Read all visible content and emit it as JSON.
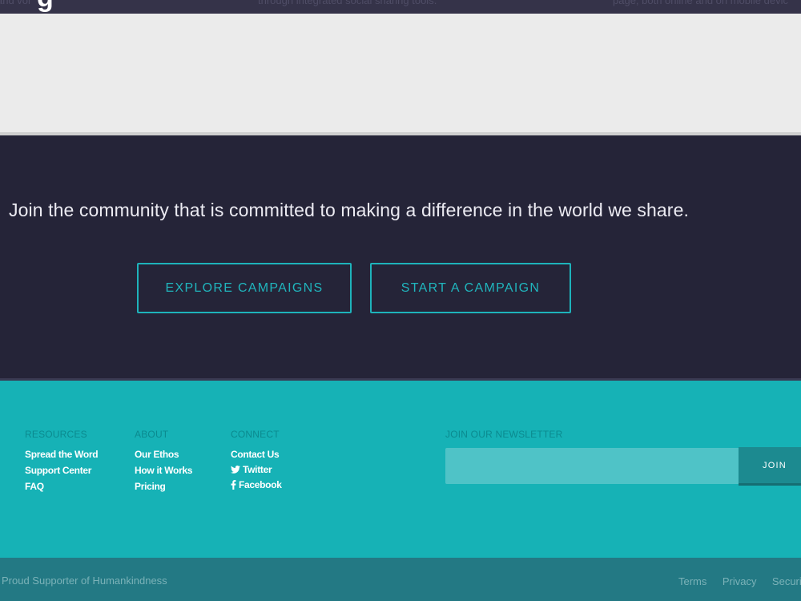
{
  "top_strip": {
    "left_fragment": "and vol",
    "big_char": "g",
    "mid_fragment": "through integrated social sharing tools.",
    "right_fragment": "page, both online and on mobile devic"
  },
  "cta": {
    "headline": "Join the community that is committed to making a difference in the world we share.",
    "explore_label": "EXPLORE CAMPAIGNS",
    "start_label": "START A CAMPAIGN",
    "accent_color": "#1eb3bb"
  },
  "footer": {
    "background_color": "#16b2b6",
    "resources": {
      "title": "RESOURCES",
      "items": [
        "Spread the Word",
        "Support Center",
        "FAQ"
      ]
    },
    "about": {
      "title": "ABOUT",
      "items": [
        "Our Ethos",
        "How it Works",
        "Pricing"
      ]
    },
    "connect": {
      "title": "CONNECT",
      "items": [
        {
          "label": "Contact Us",
          "icon": ""
        },
        {
          "label": "Twitter",
          "icon": "twitter-icon"
        },
        {
          "label": "Facebook",
          "icon": "facebook-icon"
        }
      ]
    },
    "newsletter": {
      "title": "JOIN OUR NEWSLETTER",
      "input_value": "",
      "placeholder": "",
      "button_label": "JOIN"
    }
  },
  "bottom_bar": {
    "tagline": "Proud Supporter of Humankindness",
    "links": [
      "Terms",
      "Privacy",
      "Security"
    ]
  }
}
